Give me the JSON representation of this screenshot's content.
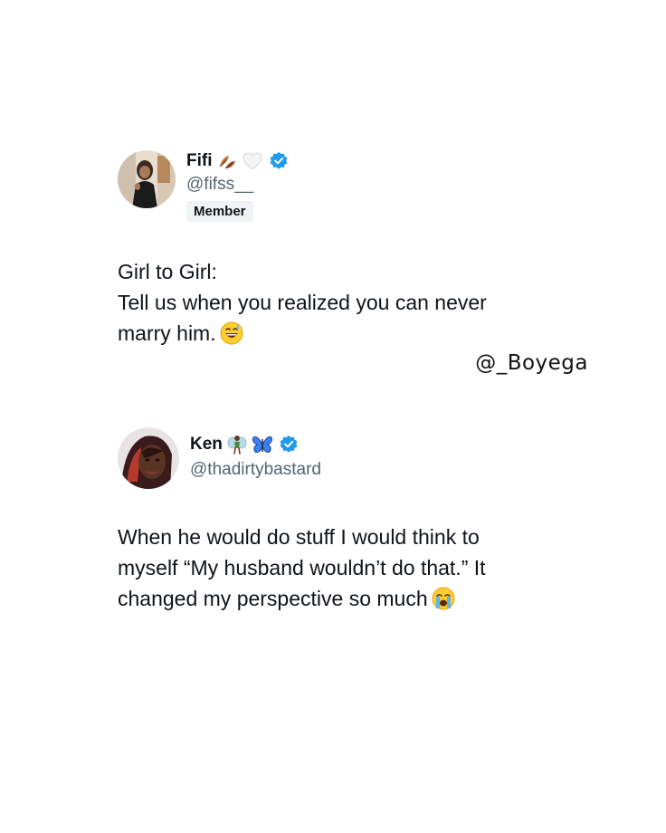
{
  "posts": [
    {
      "author": {
        "display_name": "Fifi",
        "name_emojis": [
          "fallen-leaf-icon",
          "white-heart-icon"
        ],
        "handle": "@fifss__",
        "verified": true,
        "badge": "Member",
        "avatar": "avatar-photo"
      },
      "text_lines": [
        "Girl to Girl:",
        "Tell us when you realized you can never",
        "marry him."
      ],
      "trailing_emoji": "grinning-sweat-icon"
    },
    {
      "author": {
        "display_name": "Ken",
        "name_emojis": [
          "fairy-icon",
          "butterfly-icon"
        ],
        "handle": "@thadirtybastard",
        "verified": true,
        "avatar": "avatar-photo"
      },
      "text_lines": [
        "When he would do stuff I would think to",
        "myself “My husband wouldn’t do that.” It",
        "changed my perspective so much"
      ],
      "trailing_emoji": "loudly-crying-icon"
    }
  ],
  "watermark": "@_Boyega",
  "colors": {
    "background": "#ffffff",
    "text": "#0f1419",
    "handle": "#536471",
    "verified": "#1d9bf0",
    "badge_bg": "#eff3f4"
  }
}
